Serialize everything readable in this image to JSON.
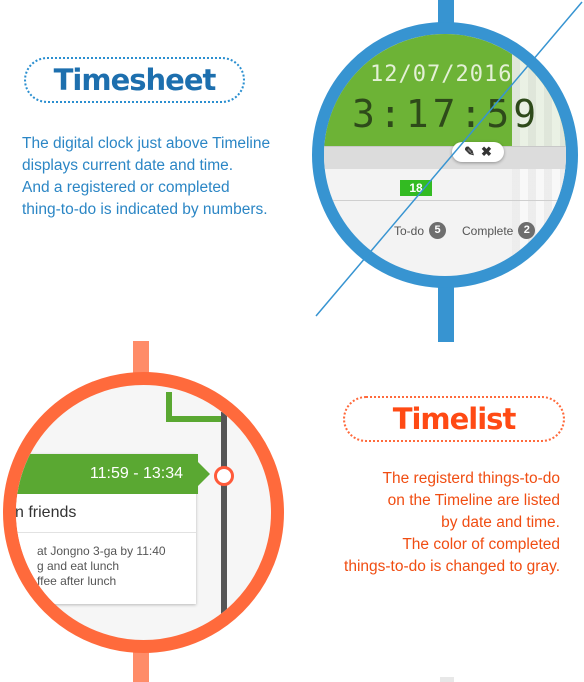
{
  "colors": {
    "blue": "#3794d1",
    "blue_text": "#2b86c5",
    "orange": "#ff6a3c",
    "orange_text": "#f04d12",
    "green": "#5aa832"
  },
  "timesheet": {
    "title": "Timesheet",
    "description_lines": [
      "The digital clock just above Timeline",
      "displays current date and time.",
      "And a registered or completed",
      "thing-to-do is indicated by numbers."
    ],
    "zoom": {
      "date": "12/07/2016",
      "time": "3:17:59",
      "marker": "18",
      "todo_label": "To-do",
      "todo_count": "5",
      "complete_label": "Complete",
      "complete_count": "2",
      "edit_icon": "edit-icon",
      "close_icon": "close-icon"
    }
  },
  "timelist": {
    "title": "Timelist",
    "description_lines": [
      "The registerd things-to-do",
      "on the Timeline are listed",
      "by date and time.",
      "The color of completed",
      "things-to-do is changed to gray."
    ],
    "zoom": {
      "time_range": "11:59 - 13:34",
      "item_title": "n friends",
      "item_desc_lines": [
        "at Jongno 3-ga by 11:40",
        "g and eat lunch",
        "ffee after lunch"
      ]
    }
  }
}
